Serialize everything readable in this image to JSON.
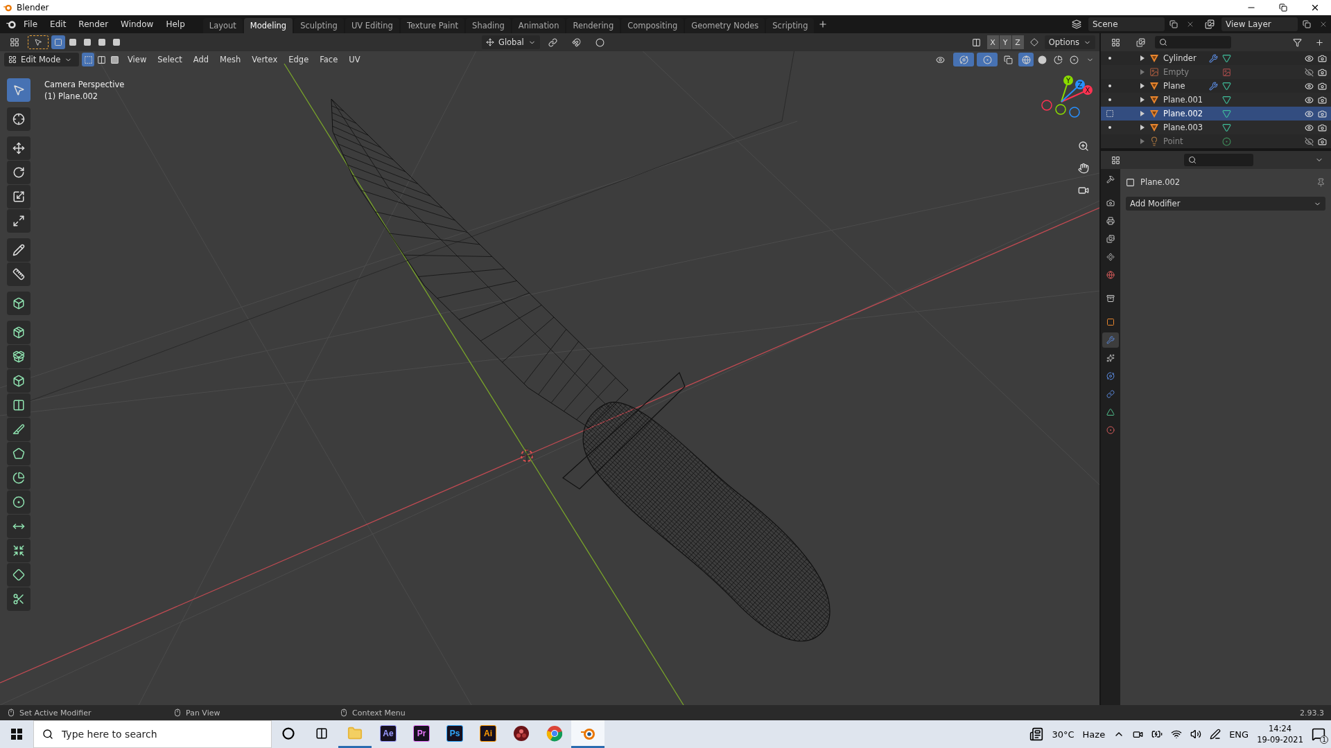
{
  "window": {
    "title": "Blender"
  },
  "menu": [
    "File",
    "Edit",
    "Render",
    "Window",
    "Help"
  ],
  "workspaces": [
    {
      "label": "Layout",
      "selected": false
    },
    {
      "label": "Modeling",
      "selected": true
    },
    {
      "label": "Sculpting",
      "selected": false
    },
    {
      "label": "UV Editing",
      "selected": false
    },
    {
      "label": "Texture Paint",
      "selected": false
    },
    {
      "label": "Shading",
      "selected": false
    },
    {
      "label": "Animation",
      "selected": false
    },
    {
      "label": "Rendering",
      "selected": false
    },
    {
      "label": "Compositing",
      "selected": false
    },
    {
      "label": "Geometry Nodes",
      "selected": false
    },
    {
      "label": "Scripting",
      "selected": false
    }
  ],
  "scene": "Scene",
  "view_layer": "View Layer",
  "tool_header": {
    "orientation": "Global",
    "axes": [
      {
        "label": "X",
        "selected": false
      },
      {
        "label": "Y",
        "selected": false
      },
      {
        "label": "Z",
        "selected": false
      }
    ],
    "options": "Options"
  },
  "viewport_header": {
    "mode": "Edit Mode",
    "select_modes": [
      {
        "kind": "vertex",
        "selected": true
      },
      {
        "kind": "edge",
        "selected": false
      },
      {
        "kind": "face",
        "selected": false
      }
    ],
    "menus": [
      "View",
      "Select",
      "Add",
      "Mesh",
      "Vertex",
      "Edge",
      "Face",
      "UV"
    ]
  },
  "viewport_info": [
    "Camera Perspective",
    "(1) Plane.002"
  ],
  "tools": [
    {
      "kind": "select",
      "selected": true
    },
    {
      "kind": "cursor",
      "selected": false
    },
    {
      "kind": "move",
      "selected": false
    },
    {
      "kind": "rotate",
      "selected": false
    },
    {
      "kind": "scale",
      "selected": false
    },
    {
      "kind": "transform",
      "selected": false
    },
    {
      "kind": "annotate",
      "selected": false
    },
    {
      "kind": "measure",
      "selected": false
    },
    {
      "kind": "add_cube",
      "selected": false
    },
    {
      "kind": "extrude",
      "selected": false
    },
    {
      "kind": "inset",
      "selected": false
    },
    {
      "kind": "bevel",
      "selected": false
    },
    {
      "kind": "loop_cut",
      "selected": false
    },
    {
      "kind": "knife",
      "selected": false
    },
    {
      "kind": "poly_build",
      "selected": false
    },
    {
      "kind": "spin",
      "selected": false
    },
    {
      "kind": "smooth",
      "selected": false
    },
    {
      "kind": "edge_slide",
      "selected": false
    },
    {
      "kind": "shrink",
      "selected": false
    },
    {
      "kind": "shear",
      "selected": false
    },
    {
      "kind": "rip",
      "selected": false
    }
  ],
  "gizmo": {
    "axes": [
      {
        "label": "X",
        "color": "#ff3352"
      },
      {
        "label": "Y",
        "color": "#8bdc00"
      },
      {
        "label": "Z",
        "color": "#2890ff"
      }
    ]
  },
  "outliner": {
    "items": [
      {
        "name": "Cylinder",
        "kind": "mesh",
        "selected": false,
        "visible": true,
        "has_modifier": true
      },
      {
        "name": "Empty",
        "kind": "empty",
        "selected": false,
        "visible": false,
        "has_modifier": false
      },
      {
        "name": "Plane",
        "kind": "mesh",
        "selected": false,
        "visible": true,
        "has_modifier": true
      },
      {
        "name": "Plane.001",
        "kind": "mesh",
        "selected": false,
        "visible": true,
        "has_modifier": false
      },
      {
        "name": "Plane.002",
        "kind": "mesh",
        "selected": true,
        "visible": true,
        "has_modifier": false
      },
      {
        "name": "Plane.003",
        "kind": "mesh",
        "selected": false,
        "visible": true,
        "has_modifier": false
      },
      {
        "name": "Point",
        "kind": "light",
        "selected": false,
        "visible": false,
        "has_modifier": false
      }
    ]
  },
  "properties": {
    "object": "Plane.002",
    "add_modifier": "Add Modifier",
    "tabs": [
      {
        "kind": "tool",
        "selected": false
      },
      {
        "kind": "render",
        "selected": false
      },
      {
        "kind": "output",
        "selected": false
      },
      {
        "kind": "view_layer",
        "selected": false
      },
      {
        "kind": "scene",
        "selected": false
      },
      {
        "kind": "world",
        "selected": false
      },
      {
        "kind": "collection",
        "selected": false
      },
      {
        "kind": "object",
        "selected": false
      },
      {
        "kind": "modifier",
        "selected": true
      },
      {
        "kind": "particles",
        "selected": false
      },
      {
        "kind": "physics",
        "selected": false
      },
      {
        "kind": "constraints",
        "selected": false
      },
      {
        "kind": "data",
        "selected": false
      },
      {
        "kind": "material",
        "selected": false
      }
    ]
  },
  "status_bar": {
    "hints": [
      "Set Active Modifier",
      "Pan View",
      "Context Menu"
    ],
    "version": "2.93.3"
  },
  "taskbar": {
    "search": {
      "placeholder": "Type here to search"
    },
    "apps": [
      {
        "kind": "folder",
        "running": true,
        "selected": false
      },
      {
        "kind": "letters",
        "label": "Ae",
        "color": "#9999ff",
        "running": false,
        "selected": false
      },
      {
        "kind": "letters",
        "label": "Pr",
        "color": "#ea77ff",
        "running": false,
        "selected": false
      },
      {
        "kind": "letters",
        "label": "Ps",
        "color": "#31a8ff",
        "running": false,
        "selected": false
      },
      {
        "kind": "letters",
        "label": "Ai",
        "color": "#ff9a00",
        "running": false,
        "selected": false
      },
      {
        "kind": "resolve",
        "running": false,
        "selected": false
      },
      {
        "kind": "browser",
        "running": false,
        "selected": false
      },
      {
        "kind": "blender",
        "running": true,
        "selected": true
      }
    ],
    "temperature": "30°C",
    "weather": "Haze",
    "language": "ENG",
    "time": "14:24",
    "date": "19-09-2021",
    "notifications": "1"
  }
}
